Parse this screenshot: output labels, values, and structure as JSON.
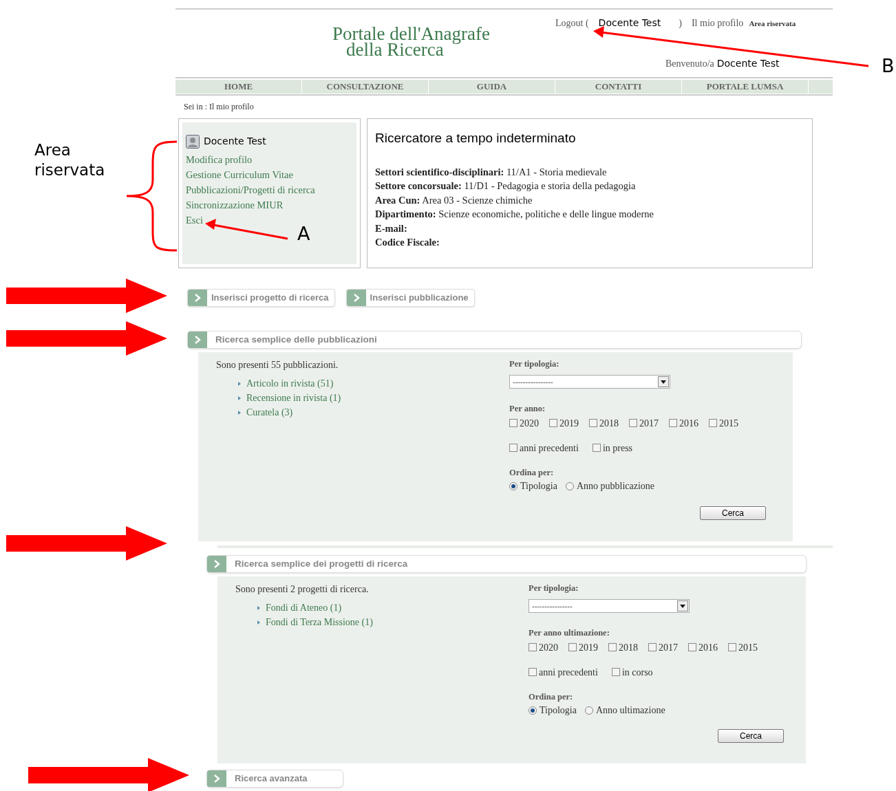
{
  "header": {
    "title_lines": [
      "Portale dell'Anagrafe",
      "della Ricerca"
    ],
    "logout_open": "Logout (",
    "user": "Docente Test",
    "logout_close": ")",
    "profile_link": "Il mio profilo",
    "area_link": "Area riservata",
    "welcome": "Benvenuto/a",
    "welcome_user": "Docente Test"
  },
  "nav": [
    "HOME",
    "CONSULTAZIONE",
    "GUIDA",
    "CONTATTI",
    "PORTALE LUMSA"
  ],
  "breadcrumb": "Sei in : Il mio profilo",
  "sidebar": {
    "user": "Docente Test",
    "items": [
      "Modifica profilo",
      "Gestione Curriculum Vitae",
      "Pubblicazioni/Progetti di ricerca",
      "Sincronizzazione MIUR",
      "Esci"
    ]
  },
  "profile": {
    "role": "Ricercatore a tempo indeterminato",
    "fields": [
      {
        "label": "Settori scientifico-disciplinari:",
        "value": "11/A1 - Storia medievale"
      },
      {
        "label": "Settore concorsuale:",
        "value": "11/D1 - Pedagogia e storia della pedagogia"
      },
      {
        "label": "Area Cun:",
        "value": "Area 03 - Scienze chimiche"
      },
      {
        "label": "Dipartimento:",
        "value": "Scienze economiche, politiche e delle lingue moderne"
      },
      {
        "label": "E-mail:"
      },
      {
        "label": "Codice Fiscale:"
      }
    ]
  },
  "action_buttons": [
    "Inserisci progetto di ricerca",
    "Inserisci pubblicazione"
  ],
  "sections": [
    {
      "title": "Ricerca semplice delle pubblicazioni",
      "summary": "Sono presenti 55 pubblicazioni.",
      "categories": [
        "Articolo in rivista (51)",
        "Recensione in rivista (1)",
        "Curatela (3)"
      ],
      "type_label": "Per tipologia:",
      "type_value": "----------------",
      "year_label": "Per anno:",
      "years": [
        {
          "label": "2020",
          "checked": false
        },
        {
          "label": "2019",
          "checked": false
        },
        {
          "label": "2018",
          "checked": false
        },
        {
          "label": "2017",
          "checked": false
        },
        {
          "label": "2016",
          "checked": false
        },
        {
          "label": "2015",
          "checked": false
        }
      ],
      "extra": [
        {
          "label": "anni precedenti",
          "checked": false
        },
        {
          "label": "in press",
          "checked": false
        }
      ],
      "order_label": "Ordina per:",
      "order": [
        {
          "label": "Tipologia",
          "selected": true
        },
        {
          "label": "Anno pubblicazione",
          "selected": false
        }
      ],
      "button": "Cerca"
    },
    {
      "title": "Ricerca semplice dei progetti di ricerca",
      "summary": "Sono presenti 2 progetti di ricerca.",
      "categories": [
        "Fondi di Ateneo (1)",
        "Fondi di Terza Missione (1)"
      ],
      "type_label": "Per tipologia:",
      "type_value": "----------------",
      "year_label": "Per anno ultimazione:",
      "years": [
        {
          "label": "2020",
          "checked": false
        },
        {
          "label": "2019",
          "checked": false
        },
        {
          "label": "2018",
          "checked": false
        },
        {
          "label": "2017",
          "checked": false
        },
        {
          "label": "2016",
          "checked": false
        },
        {
          "label": "2015",
          "checked": false
        }
      ],
      "extra": [
        {
          "label": "anni precedenti",
          "checked": false
        },
        {
          "label": "in corso",
          "checked": false
        }
      ],
      "order_label": "Ordina per:",
      "order": [
        {
          "label": "Tipologia",
          "selected": true
        },
        {
          "label": "Anno ultimazione",
          "selected": false
        }
      ],
      "button": "Cerca"
    }
  ],
  "advanced": "Ricerca avanzata",
  "annotations": {
    "bracket_label": "Area riservata",
    "marker_a": "A",
    "marker_b": "B"
  }
}
